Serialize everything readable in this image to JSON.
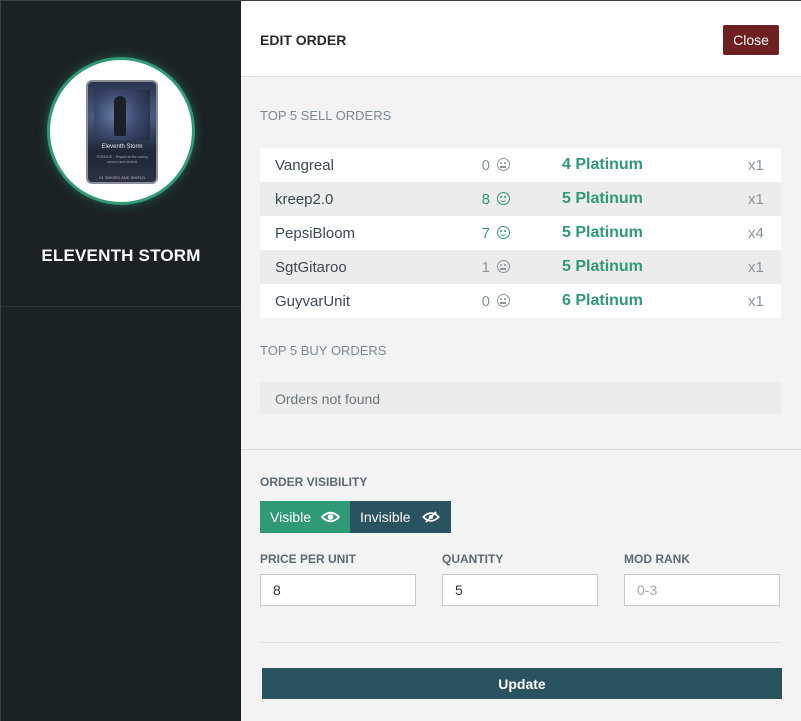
{
  "item": {
    "title": "ELEVENTH STORM",
    "card_name": "Eleventh Storm",
    "card_desc": "STANCE - Rapid strike using sword and shield",
    "card_footer": "V1  SWORD AND SHIELD"
  },
  "header": {
    "title": "EDIT ORDER",
    "close_label": "Close"
  },
  "sell_orders": {
    "title": "TOP 5 SELL ORDERS",
    "rows": [
      {
        "user": "Vangreal",
        "reputation": "0",
        "mood": "neutral",
        "price": "4 Platinum",
        "quantity": "x1"
      },
      {
        "user": "kreep2.0",
        "reputation": "8",
        "mood": "positive",
        "price": "5 Platinum",
        "quantity": "x1"
      },
      {
        "user": "PepsiBloom",
        "reputation": "7",
        "mood": "positive",
        "price": "5 Platinum",
        "quantity": "x4"
      },
      {
        "user": "SgtGitaroo",
        "reputation": "1",
        "mood": "neutral",
        "price": "5 Platinum",
        "quantity": "x1"
      },
      {
        "user": "GuyvarUnit",
        "reputation": "0",
        "mood": "neutral",
        "price": "6 Platinum",
        "quantity": "x1"
      }
    ]
  },
  "buy_orders": {
    "title": "TOP 5 BUY ORDERS",
    "empty_text": "Orders not found"
  },
  "form": {
    "visibility_label": "ORDER VISIBILITY",
    "visible_label": "Visible",
    "invisible_label": "Invisible",
    "price_label": "PRICE PER UNIT",
    "price_value": "8",
    "quantity_label": "QUANTITY",
    "quantity_value": "5",
    "rank_label": "MOD RANK",
    "rank_placeholder": "0-3",
    "update_label": "Update"
  },
  "colors": {
    "accent_green": "#2f9a73",
    "close_red": "#6e1f1f",
    "teal_dark": "#2a5360",
    "sidebar_bg": "#1b2226"
  }
}
